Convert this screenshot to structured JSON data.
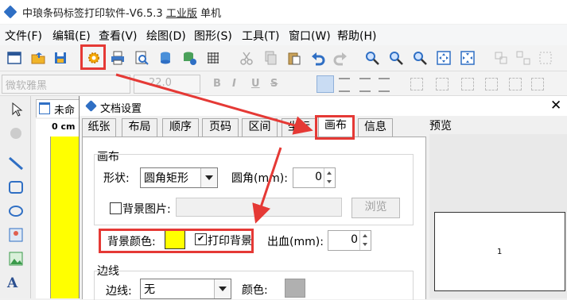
{
  "app": {
    "title": "中琅条码标签打印软件-V6.5.3",
    "edition": "工业版",
    "mode": "单机"
  },
  "menu": [
    "文件(F)",
    "编辑(E)",
    "查看(V)",
    "绘图(D)",
    "图形(S)",
    "工具(T)",
    "窗口(W)",
    "帮助(H)"
  ],
  "format_toolbar": {
    "font": "微软雅黑",
    "size": "22.0",
    "bold": "B",
    "italic": "I",
    "underline": "U",
    "strike": "S"
  },
  "document": {
    "tab_label": "未命名",
    "ruler_unit": "0 cm"
  },
  "dialog": {
    "title": "文档设置",
    "close": "✕",
    "tabs": [
      "纸张",
      "布局",
      "顺序",
      "页码",
      "区间",
      "坐标",
      "画布",
      "信息"
    ],
    "active_tab": "画布",
    "canvas_group": {
      "title": "画布",
      "shape_label": "形状:",
      "shape_value": "圆角矩形",
      "corner_label": "圆角(mm):",
      "corner_value": "0",
      "bg_image_label": "背景图片:",
      "browse_label": "浏览",
      "bg_color_label": "背景颜色:",
      "bg_color": "#ffff00",
      "print_bg_label": "打印背景",
      "print_bg_checked": "✔",
      "bleed_label": "出血(mm):",
      "bleed_value": "0"
    },
    "border_group": {
      "title": "边线",
      "border_label": "边线:",
      "border_value": "无",
      "color_label": "颜色:",
      "color_value": "#b0b0b0"
    },
    "preview": {
      "title": "预览",
      "page_number": "1"
    }
  },
  "colors": {
    "accent_red": "#e53935",
    "canvas_yellow": "#ffff00",
    "brand_blue": "#2f6fc4"
  }
}
